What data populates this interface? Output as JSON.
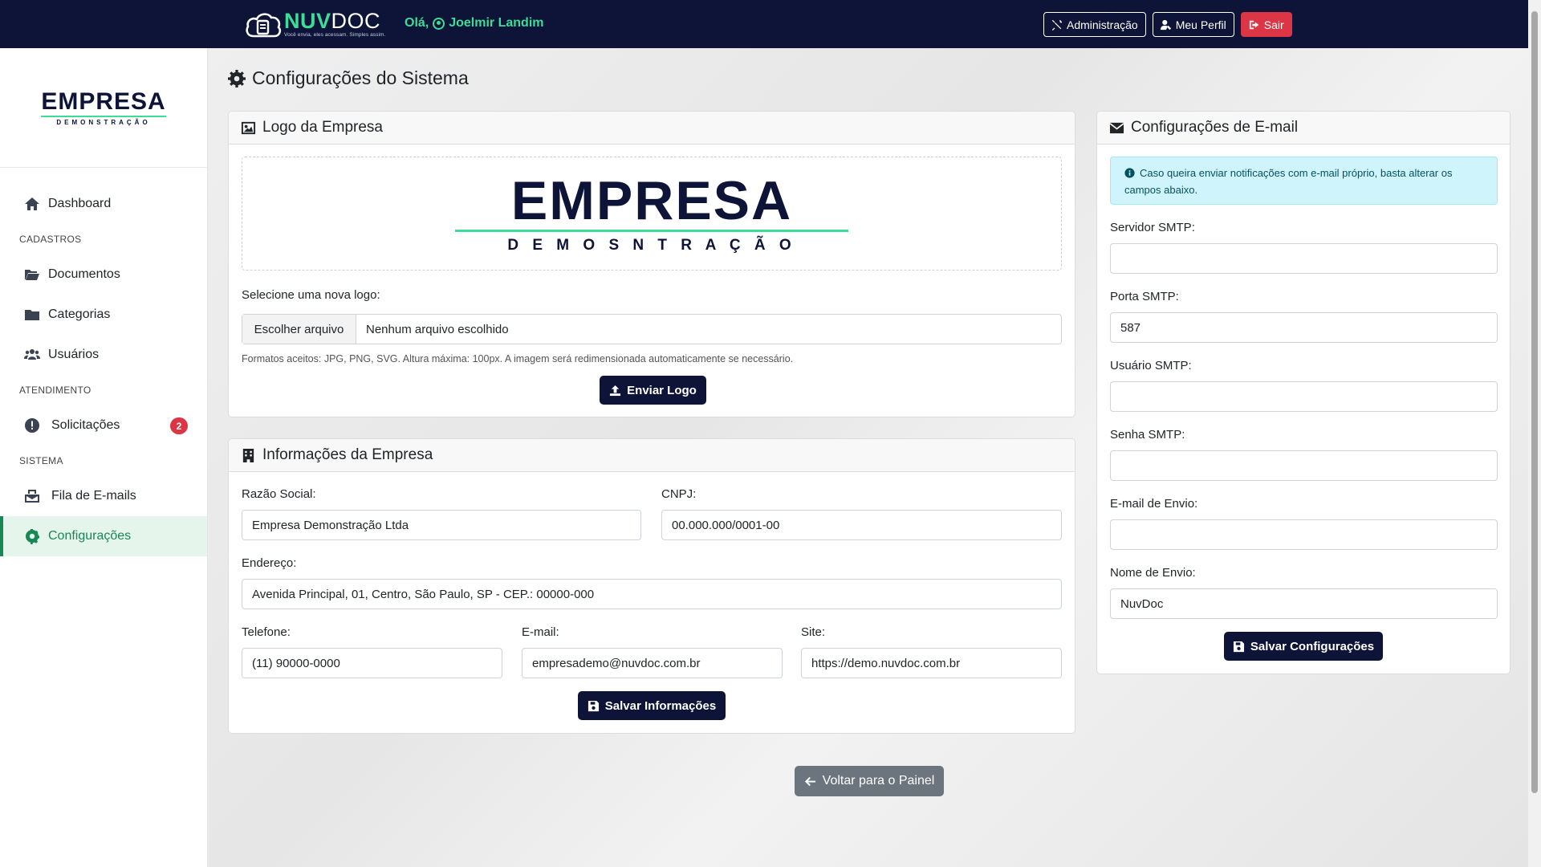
{
  "topbar": {
    "brand_nuv": "NUV",
    "brand_doc": "DOC",
    "brand_tagline": "Você envia, eles acessam. Simples assim.",
    "greeting": "Olá,",
    "user_name": "Joelmir Landim",
    "admin_label": "Administração",
    "profile_label": "Meu Perfil",
    "logout_label": "Sair"
  },
  "sidebar": {
    "logo_word": "EMPRESA",
    "logo_sub": "DEMONSTRAÇÃO",
    "dashboard": "Dashboard",
    "section_cadastros": "CADASTROS",
    "documentos": "Documentos",
    "categorias": "Categorias",
    "usuarios": "Usuários",
    "section_atendimento": "ATENDIMENTO",
    "solicitacoes": "Solicitações",
    "solicitacoes_badge": "2",
    "section_sistema": "SISTEMA",
    "fila_emails": "Fila de E-mails",
    "configuracoes": "Configurações"
  },
  "main": {
    "page_title": "Configurações do Sistema",
    "logo_card": {
      "title": "Logo da Empresa",
      "preview_word": "EMPRESA",
      "preview_sub": "D E M O S N T R A Ç Ã O",
      "select_label": "Selecione uma nova logo:",
      "choose_button": "Escolher arquivo",
      "no_file": "Nenhum arquivo escolhido",
      "help_text": "Formatos aceitos: JPG, PNG, SVG. Altura máxima: 100px. A imagem será redimensionada automaticamente se necessário.",
      "upload_button": "Enviar Logo"
    },
    "company_card": {
      "title": "Informações da Empresa",
      "razao_label": "Razão Social:",
      "razao_value": "Empresa Demonstração Ltda",
      "cnpj_label": "CNPJ:",
      "cnpj_value": "00.000.000/0001-00",
      "endereco_label": "Endereço:",
      "endereco_value": "Avenida Principal, 01, Centro, São Paulo, SP - CEP.: 00000-000",
      "telefone_label": "Telefone:",
      "telefone_value": "(11) 90000-0000",
      "email_label": "E-mail:",
      "email_value": "empresademo@nuvdoc.com.br",
      "site_label": "Site:",
      "site_value": "https://demo.nuvdoc.com.br",
      "save_button": "Salvar Informações"
    },
    "email_card": {
      "title": "Configurações de E-mail",
      "alert": "Caso queira enviar notificações com e-mail próprio, basta alterar os campos abaixo.",
      "smtp_server_label": "Servidor SMTP:",
      "smtp_server_value": "",
      "smtp_port_label": "Porta SMTP:",
      "smtp_port_value": "587",
      "smtp_user_label": "Usuário SMTP:",
      "smtp_user_value": "",
      "smtp_pass_label": "Senha SMTP:",
      "smtp_pass_value": "",
      "from_email_label": "E-mail de Envio:",
      "from_email_value": "",
      "from_name_label": "Nome de Envio:",
      "from_name_value": "NuvDoc",
      "save_button": "Salvar Configurações"
    },
    "back_button": "Voltar para o Painel"
  },
  "colors": {
    "navbar": "#0d1438",
    "brand_green": "#3ddc97",
    "active_green": "#198754",
    "danger": "#dc3545",
    "secondary": "#6c757d",
    "info_bg": "#cff4fc"
  },
  "icons": {
    "admin": "tools-icon",
    "profile": "user-edit-icon",
    "logout": "sign-out-icon",
    "dashboard": "home-icon",
    "documentos": "folder-open-icon",
    "categorias": "folder-icon",
    "usuarios": "users-icon",
    "solicitacoes": "exclamation-circle-icon",
    "fila_emails": "envelope-inbox-icon",
    "configuracoes": "gear-icon",
    "logo_card": "image-icon",
    "company_card": "building-icon",
    "email_card": "envelope-icon",
    "upload": "upload-icon",
    "save": "floppy-disk-icon",
    "back": "arrow-left-icon"
  }
}
